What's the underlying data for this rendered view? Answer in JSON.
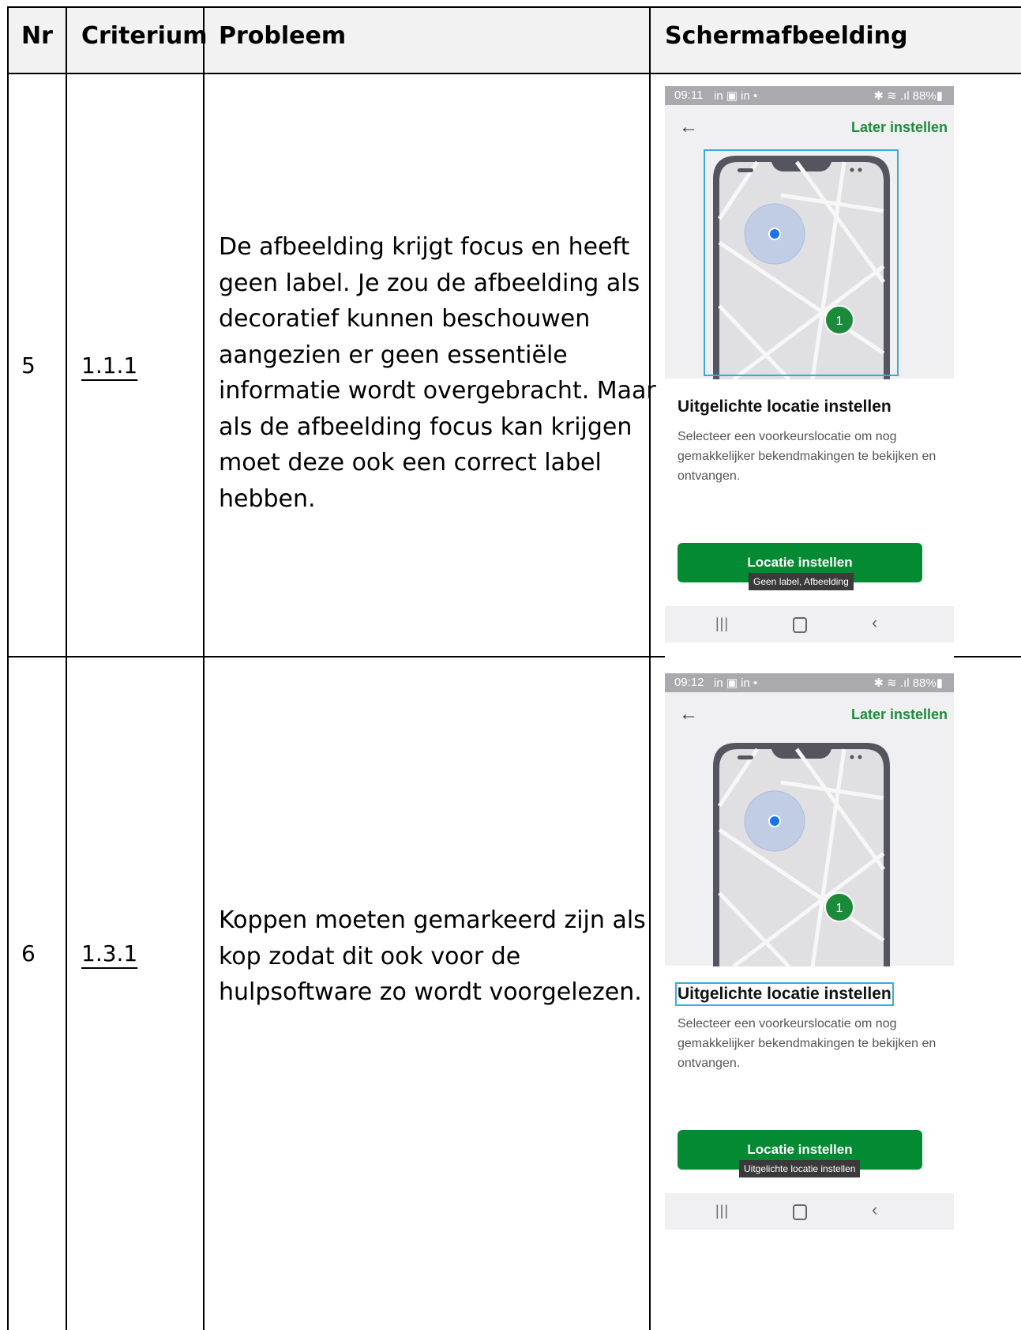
{
  "table": {
    "headers": [
      "Nr",
      "Criterium",
      "Probleem",
      "Schermafbeelding"
    ],
    "rows": [
      {
        "nr": "5",
        "criterium": "1.1.1",
        "probleem": "De afbeelding krijgt focus en heeft geen label. Je zou de afbeelding als decoratief kunnen beschouwen aangezien er geen essentiële informatie wordt overgebracht. Maar als de afbeelding focus kan krijgen moet deze ook een correct label hebben.",
        "screenshot": {
          "time": "09:11",
          "status_icons": "in ▣ in •",
          "status_right": "✱ ≋ .ıl 88%▮",
          "back_icon": "←",
          "later_label": "Later instellen",
          "title": "Uitgelichte locatie instellen",
          "body": "Selecteer een voorkeurslocatie om nog gemakkelijker bekendmakingen te bekijken en ontvangen.",
          "button_label": "Locatie instellen",
          "tooltip": "Geen label, Afbeelding",
          "marker_number": "1",
          "focus_on": "image"
        }
      },
      {
        "nr": "6",
        "criterium": "1.3.1",
        "probleem": "Koppen moeten gemarkeerd zijn als kop zodat dit ook voor de hulpsoftware zo wordt voorgelezen.",
        "screenshot": {
          "time": "09:12",
          "status_icons": "in ▣ in •",
          "status_right": "✱ ≋ .ıl 88%▮",
          "back_icon": "←",
          "later_label": "Later instellen",
          "title": "Uitgelichte locatie instellen",
          "body": "Selecteer een voorkeurslocatie om nog gemakkelijker bekendmakingen te bekijken en ontvangen.",
          "button_label": "Locatie instellen",
          "tooltip": "Uitgelichte locatie instellen",
          "marker_number": "1",
          "focus_on": "title"
        }
      }
    ]
  },
  "colors": {
    "header_bg": "#f2f2f2",
    "accent_green": "#058a34",
    "link_green": "#1f8a3b",
    "focus_blue": "#3ba8e0",
    "marker_blue": "#1a73e8"
  },
  "nav_icons": [
    "recent-apps-icon",
    "home-icon",
    "back-icon"
  ]
}
